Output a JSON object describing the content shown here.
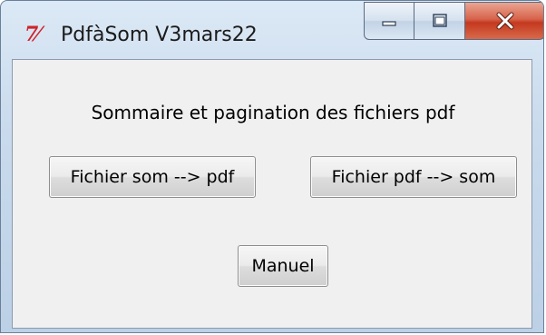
{
  "window": {
    "title": "PdfàSom V3mars22",
    "icon": "tk-feather-icon",
    "controls": {
      "minimize": "minimize-icon",
      "maximize": "maximize-icon",
      "close": "close-icon"
    }
  },
  "main": {
    "heading": "Sommaire et pagination des fichiers pdf",
    "buttons": {
      "som_to_pdf": "Fichier som --> pdf",
      "pdf_to_som": "Fichier pdf --> som",
      "manual": "Manuel"
    }
  },
  "colors": {
    "close_button": "#c4391f",
    "icon_red": "#d0232a",
    "client_background": "#f0f0f0"
  }
}
